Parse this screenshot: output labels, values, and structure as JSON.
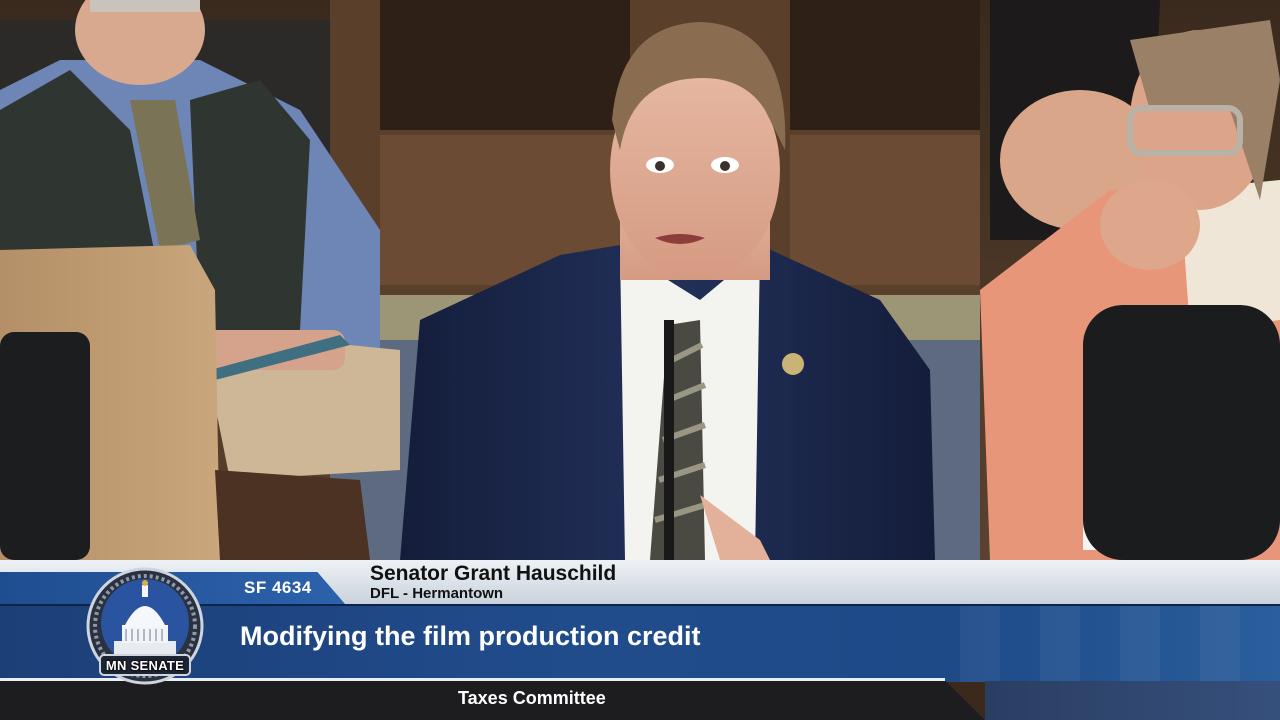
{
  "broadcast": {
    "bill_number": "SF 4634",
    "speaker_name": "Senator Grant Hauschild",
    "speaker_district": "DFL - Hermantown",
    "topic": "Modifying the film production credit",
    "committee": "Taxes Committee"
  },
  "logo": {
    "text": "MN SENATE",
    "icon": "capitol-dome-icon"
  },
  "colors": {
    "brand_blue": "#1f4e90",
    "topic_band": "#204c8c",
    "grey_band": "#dde3ea",
    "committee_band": "#1d1d1f"
  }
}
